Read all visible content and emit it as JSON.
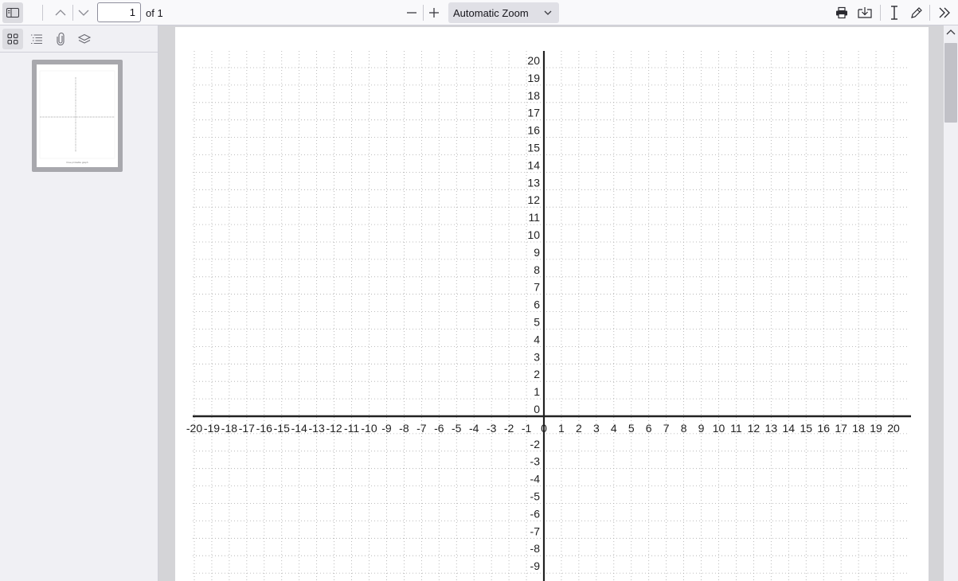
{
  "toolbar": {
    "page_number": "1",
    "page_count_label": "of 1",
    "zoom_label": "Automatic Zoom"
  },
  "sidebar": {
    "thumbnail_caption": "Free printable graph"
  },
  "chart_data": {
    "type": "grid",
    "x_ticks": [
      "-20",
      "-19",
      "-18",
      "-17",
      "-16",
      "-15",
      "-14",
      "-13",
      "-12",
      "-11",
      "-10",
      "-9",
      "-8",
      "-7",
      "-6",
      "-5",
      "-4",
      "-3",
      "-2",
      "-1",
      "0",
      "1",
      "2",
      "3",
      "4",
      "5",
      "6",
      "7",
      "8",
      "9",
      "10",
      "11",
      "12",
      "13",
      "14",
      "15",
      "16",
      "17",
      "18",
      "19",
      "20"
    ],
    "y_ticks": [
      "20",
      "19",
      "18",
      "17",
      "16",
      "15",
      "14",
      "13",
      "12",
      "11",
      "10",
      "9",
      "8",
      "7",
      "6",
      "5",
      "4",
      "3",
      "2",
      "1",
      "0",
      "-2",
      "-3",
      "-4",
      "-5",
      "-6",
      "-7",
      "-8",
      "-9"
    ],
    "xlim": [
      -20,
      20
    ],
    "ylim": [
      -20,
      20
    ],
    "grid": "dotted"
  }
}
